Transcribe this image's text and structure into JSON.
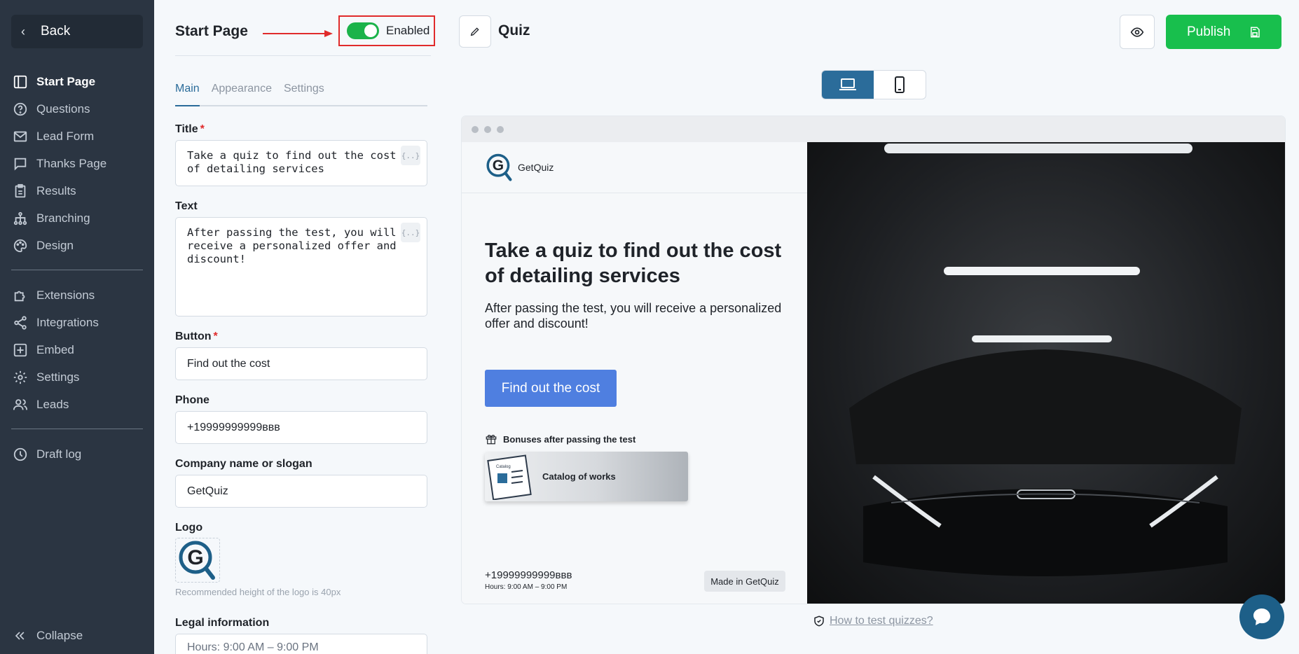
{
  "sidebar": {
    "back_label": "Back",
    "items": [
      {
        "label": "Start Page",
        "icon": "layout-icon",
        "active": true
      },
      {
        "label": "Questions",
        "icon": "question-circle-icon"
      },
      {
        "label": "Lead Form",
        "icon": "mail-icon"
      },
      {
        "label": "Thanks Page",
        "icon": "message-square-icon"
      },
      {
        "label": "Results",
        "icon": "clipboard-icon"
      },
      {
        "label": "Branching",
        "icon": "branching-icon"
      },
      {
        "label": "Design",
        "icon": "palette-icon"
      }
    ],
    "items2": [
      {
        "label": "Extensions",
        "icon": "puzzle-icon"
      },
      {
        "label": "Integrations",
        "icon": "integrations-icon"
      },
      {
        "label": "Embed",
        "icon": "plus-square-icon"
      },
      {
        "label": "Settings",
        "icon": "gear-icon"
      },
      {
        "label": "Leads",
        "icon": "users-icon"
      }
    ],
    "items3": [
      {
        "label": "Draft log",
        "icon": "history-icon"
      }
    ],
    "collapse_label": "Collapse"
  },
  "panel": {
    "title": "Start Page",
    "toggle_label": "Enabled",
    "toggle_on": true,
    "tabs": [
      "Main",
      "Appearance",
      "Settings"
    ],
    "fields": {
      "title_label": "Title",
      "title_value": "Take a quiz to find out the cost of detailing services",
      "text_label": "Text",
      "text_value": "After passing the test, you will receive a personalized offer and discount!",
      "button_label": "Button",
      "button_value": "Find out the cost",
      "phone_label": "Phone",
      "phone_value": "+19999999999ввв",
      "company_label": "Company name or slogan",
      "company_value": "GetQuiz",
      "logo_label": "Logo",
      "logo_hint": "Recommended height of the logo is 40px",
      "legal_label": "Legal information",
      "legal_value": "Hours: 9:00 AM – 9:00 PM",
      "var_btn": "{..}"
    }
  },
  "topbar": {
    "quiz_title": "Quiz",
    "publish_label": "Publish"
  },
  "preview": {
    "brand": "GetQuiz",
    "heading": "Take a quiz to find out the cost of detailing services",
    "text": "After passing the test, you will receive a personalized offer and discount!",
    "cta": "Find out the cost",
    "bonus_title": "Bonuses after passing the test",
    "bonus_item": "Catalog of works",
    "bonus_thumb_text": "Catalog",
    "phone": "+19999999999ввв",
    "hours": "Hours: 9:00 AM – 9:00 PM",
    "made_in": "Made in GetQuiz"
  },
  "help_link": "How to test quizzes?",
  "colors": {
    "sidebar_bg": "#2b3542",
    "accent": "#2b6c9a",
    "publish": "#18bf4d",
    "cta": "#4f7fe0",
    "highlight": "#e02b2b"
  }
}
